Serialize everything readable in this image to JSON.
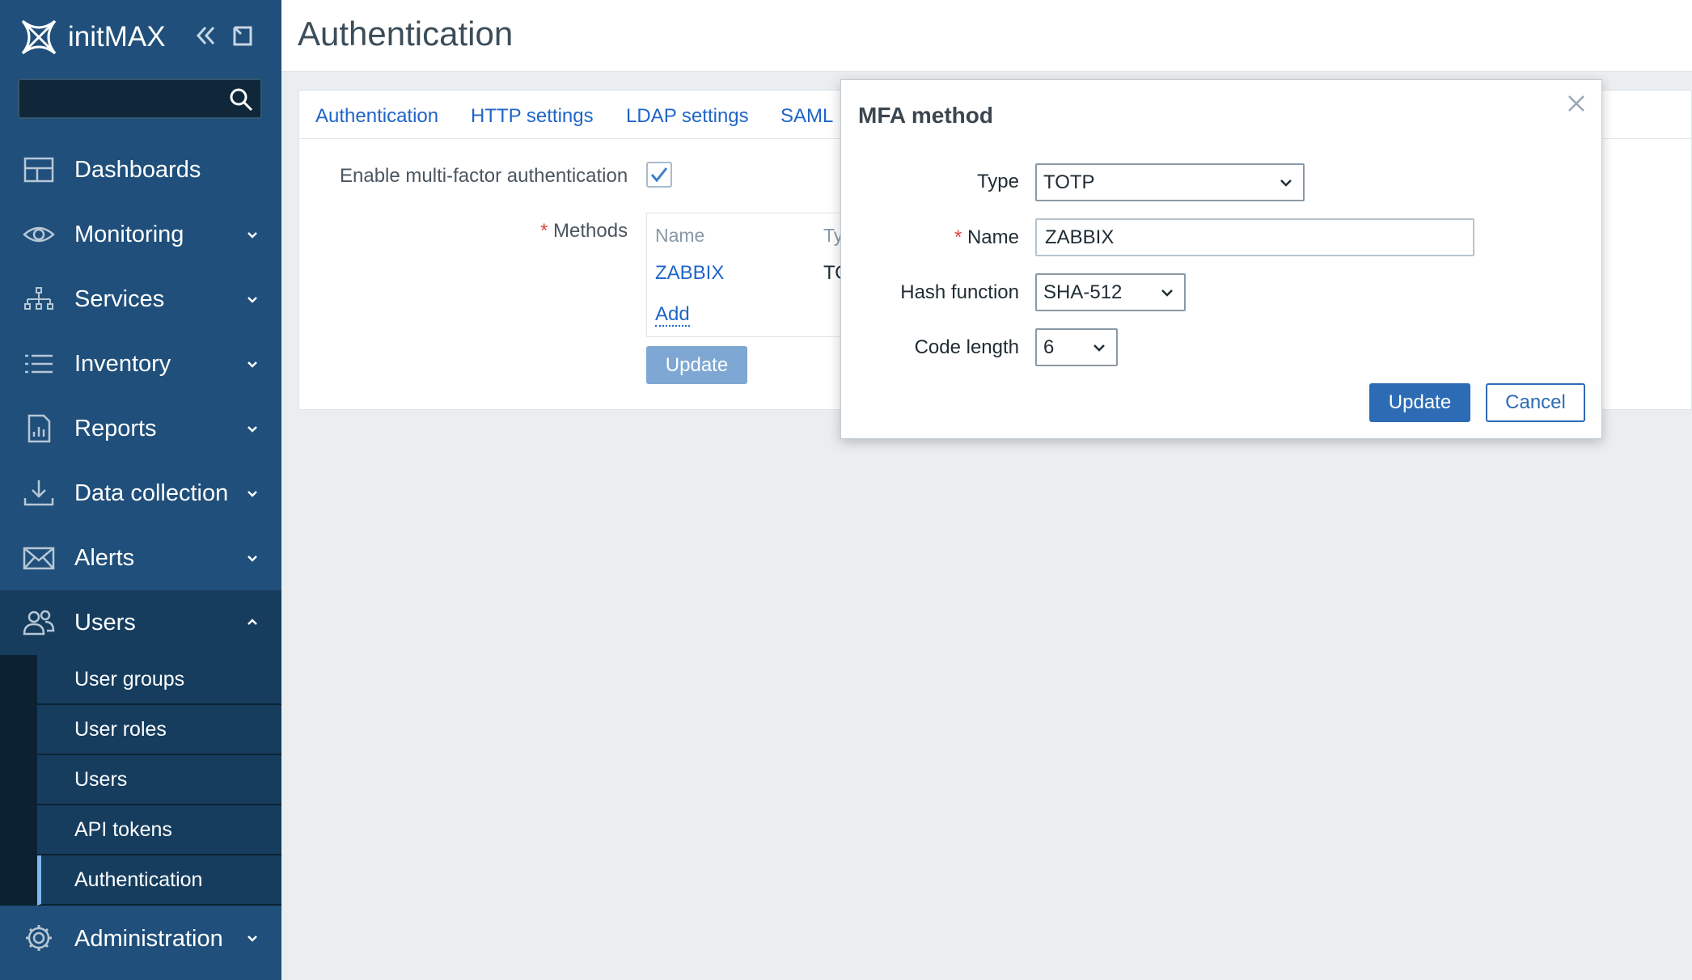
{
  "brand": {
    "name": "initMAX"
  },
  "sidebar": {
    "search": {
      "placeholder": "",
      "value": ""
    },
    "menu": [
      {
        "label": "Dashboards",
        "icon": "dashboard-icon"
      },
      {
        "label": "Monitoring",
        "icon": "eye-icon"
      },
      {
        "label": "Services",
        "icon": "services-tree-icon"
      },
      {
        "label": "Inventory",
        "icon": "list-icon"
      },
      {
        "label": "Reports",
        "icon": "report-icon"
      },
      {
        "label": "Data collection",
        "icon": "download-icon"
      },
      {
        "label": "Alerts",
        "icon": "envelope-icon"
      },
      {
        "label": "Users",
        "icon": "users-icon"
      },
      {
        "label": "Administration",
        "icon": "gear-icon"
      }
    ],
    "users_submenu": [
      "User groups",
      "User roles",
      "Users",
      "API tokens",
      "Authentication"
    ]
  },
  "header": {
    "title": "Authentication"
  },
  "tabs": [
    "Authentication",
    "HTTP settings",
    "LDAP settings",
    "SAML"
  ],
  "form": {
    "mfa_label": "Enable multi-factor authentication",
    "mfa_checked": true,
    "methods_label": "Methods",
    "required_mark": "*",
    "methods_headers": {
      "name": "Name",
      "type": "Ty"
    },
    "methods_rows": [
      {
        "name": "ZABBIX",
        "type": "TO"
      }
    ],
    "add_link": "Add",
    "update_button": "Update"
  },
  "modal": {
    "title": "MFA method",
    "type_label": "Type",
    "type_value": "TOTP",
    "name_label": "Name",
    "name_value": "ZABBIX",
    "hash_label": "Hash function",
    "hash_value": "SHA-512",
    "code_length_label": "Code length",
    "code_length_value": "6",
    "update_button": "Update",
    "cancel_button": "Cancel"
  },
  "colors": {
    "sidebar": "#1f4f7a",
    "link": "#1f65c8",
    "primary": "#2d6cb5"
  }
}
